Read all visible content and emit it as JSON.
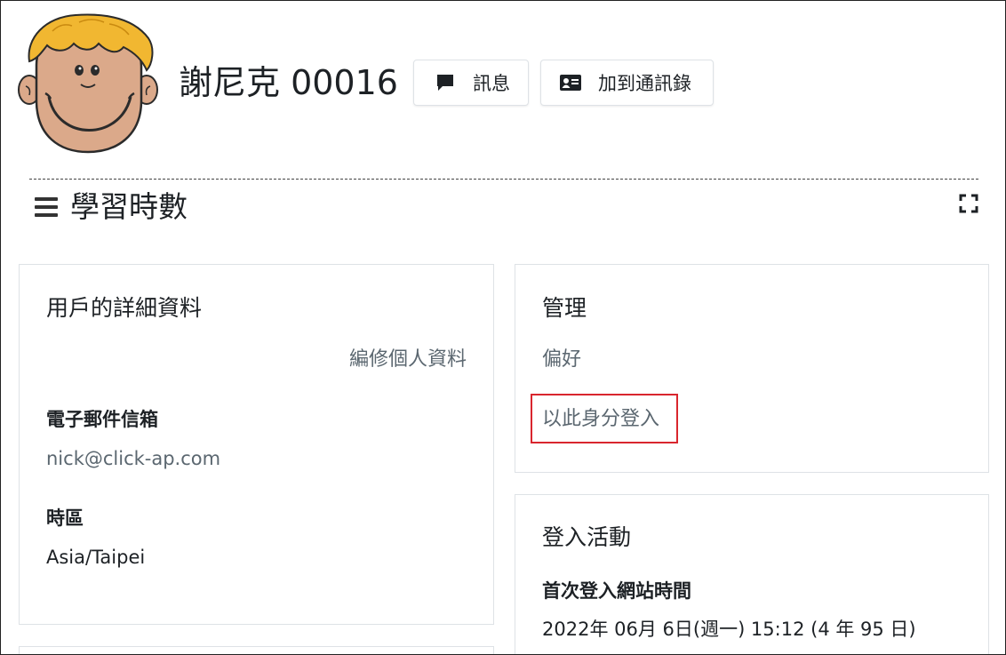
{
  "header": {
    "user_name": "謝尼克 00016",
    "message_button": "訊息",
    "add_contact_button": "加到通訊錄",
    "avatar_icon": "cartoon-face-avatar",
    "message_icon": "speech-bubble-icon",
    "contact_icon": "address-card-icon"
  },
  "block": {
    "title": "學習時數",
    "menu_icon": "hamburger-icon",
    "fullscreen_icon": "fullscreen-icon"
  },
  "user_details": {
    "title": "用戶的詳細資料",
    "edit_profile_link": "編修個人資料",
    "email_label": "電子郵件信箱",
    "email_value": "nick@click-ap.com",
    "timezone_label": "時區",
    "timezone_value": "Asia/Taipei"
  },
  "administration": {
    "title": "管理",
    "preferences_link": "偏好",
    "login_as_link": "以此身分登入",
    "highlight_color": "#d9262e"
  },
  "login_activity": {
    "title": "登入活動",
    "first_access_label": "首次登入網站時間",
    "first_access_value": "2022年 06月 6日(週一) 15:12  (4 年 95 日)"
  }
}
